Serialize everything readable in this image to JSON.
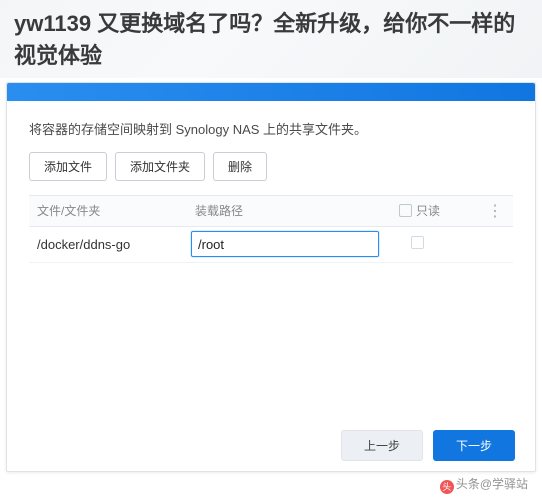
{
  "article_title": "yw1139 又更换域名了吗？全新升级，给你不一样的视觉体验",
  "modal": {
    "description": "将容器的存储空间映射到 Synology NAS 上的共享文件夹。",
    "toolbar": {
      "add_file": "添加文件",
      "add_folder": "添加文件夹",
      "delete": "删除"
    },
    "columns": {
      "file": "文件/文件夹",
      "path": "装载路径",
      "readonly": "只读",
      "menu_glyph": "⋮"
    },
    "rows": [
      {
        "file": "/docker/ddns-go",
        "path": "/root",
        "readonly": false
      }
    ],
    "footer": {
      "prev": "上一步",
      "next": "下一步"
    }
  },
  "watermark": {
    "logo_char": "头",
    "text": "头条@学驿站"
  }
}
